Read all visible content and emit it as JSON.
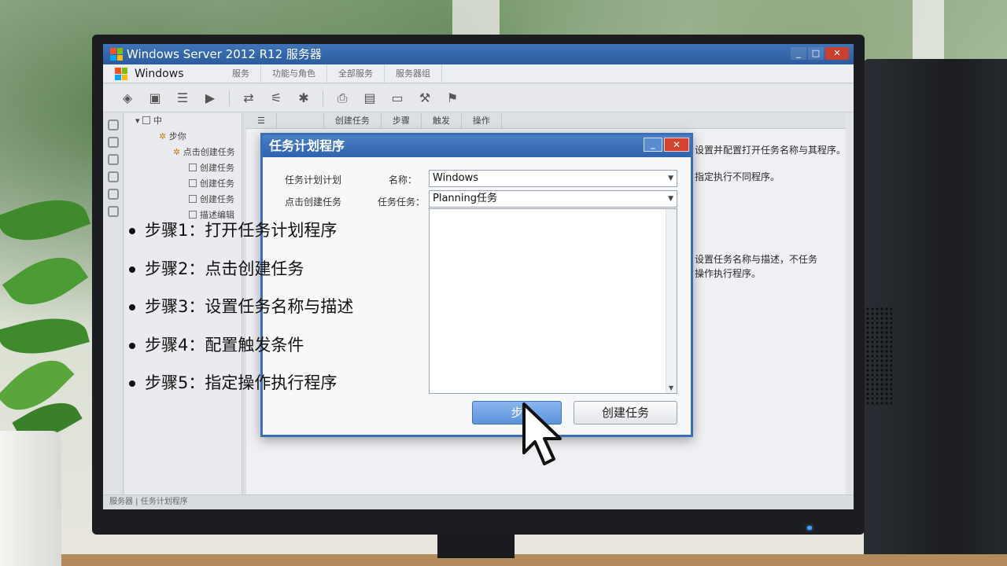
{
  "window": {
    "title": "Windows Server 2012 R12 服务器",
    "minimize": "_",
    "maximize": "□",
    "close": "✕"
  },
  "menubar": {
    "app_label": "Windows Server",
    "items": [
      "服务",
      "功能与角色",
      "全部服务",
      "服务器组"
    ]
  },
  "toolbar": {
    "icons": [
      "back-icon",
      "server-icon",
      "list-icon",
      "play-icon",
      "connect-icon",
      "config-icon",
      "settings-icon",
      "print-icon",
      "doc-icon",
      "monitor-icon",
      "tools-icon",
      "flag-icon"
    ]
  },
  "tree": {
    "items": [
      {
        "label": "中",
        "indent": 0,
        "icon": "minus"
      },
      {
        "label": "步你",
        "indent": 1,
        "icon": "gear"
      },
      {
        "label": "点击创建任务",
        "indent": 2,
        "icon": "gear"
      },
      {
        "label": "创建任务",
        "indent": 3,
        "icon": "box"
      },
      {
        "label": "创建任务",
        "indent": 3,
        "icon": "box"
      },
      {
        "label": "创建任务",
        "indent": 3,
        "icon": "box"
      },
      {
        "label": "描述编辑",
        "indent": 3,
        "icon": "box"
      }
    ]
  },
  "content": {
    "header": [
      "☰",
      "创建任务",
      "步骤",
      "触发",
      "操作"
    ],
    "desc1": "设置并配置打开任务名称与其程序。",
    "desc2": "指定执行不同程序。",
    "desc3": "设置任务名称与描述，不任务",
    "desc4": "操作执行程序。"
  },
  "statusbar": {
    "text": "服务器 | 任务计划程序"
  },
  "dialog": {
    "title": "任务计划程序",
    "minimize": "_",
    "close": "✕",
    "left_label1": "任务计划计划",
    "left_label2": "点击创建任务",
    "name_label": "名称：",
    "name_value": "Windows",
    "task_label": "任务任务：",
    "task_value": "Planning任务",
    "btn_primary": "步",
    "btn_secondary": "创建任务"
  },
  "steps": [
    "步骤1：打开任务计划程序",
    "步骤2：点击创建任务",
    "步骤3：设置任务名称与描述",
    "步骤4：配置触发条件",
    "步骤5：指定操作执行程序"
  ]
}
